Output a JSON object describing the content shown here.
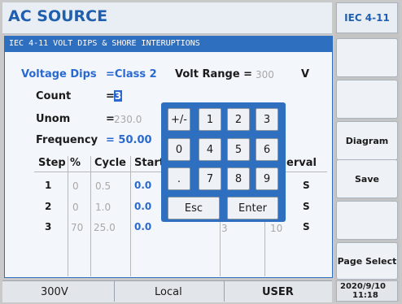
{
  "app_title": "AC SOURCE",
  "panel_header": "IEC 4-11 VOLT DIPS & SHORE INTERUPTIONS",
  "fields": {
    "voltage_dips_label": "Voltage Dips",
    "voltage_dips_value": "=Class 2",
    "volt_range_label": "Volt Range =",
    "volt_range_value": "300",
    "volt_range_unit": "V",
    "count_label": "Count",
    "count_eq": "=",
    "count_value": "3",
    "unom_label": "Unom",
    "unom_eq": "=",
    "unom_value": "230.0",
    "frequency_label": "Frequency",
    "frequency_value": "= 50.00"
  },
  "table": {
    "headers": [
      "Step",
      "%",
      "Cycle",
      "Start",
      "erval"
    ],
    "rows": [
      {
        "step": "1",
        "pct": "0",
        "cycle": "0.5",
        "start": "0.0",
        "unit": "S"
      },
      {
        "step": "2",
        "pct": "0",
        "cycle": "1.0",
        "start": "0.0",
        "unit": "S"
      },
      {
        "step": "3",
        "pct": "70",
        "cycle": "25.0",
        "start": "0.0",
        "hidden_a": "3",
        "hidden_b": "10",
        "unit": "S"
      }
    ]
  },
  "keypad": {
    "keys": [
      "+/-",
      "1",
      "2",
      "3",
      "0",
      "4",
      "5",
      "6",
      ".",
      "7",
      "8",
      "9"
    ],
    "esc": "Esc",
    "enter": "Enter"
  },
  "sidebar": {
    "title": "IEC 4-11",
    "buttons": [
      "",
      "",
      "Diagram",
      "Save",
      "",
      "Page Select"
    ]
  },
  "status": {
    "range": "300V",
    "mode": "Local",
    "user": "USER",
    "date": "2020/9/10",
    "time": "11:18"
  },
  "colors": {
    "accent": "#2e6fc0",
    "title_blue": "#1f5fae",
    "value_blue": "#2a6ad0"
  }
}
